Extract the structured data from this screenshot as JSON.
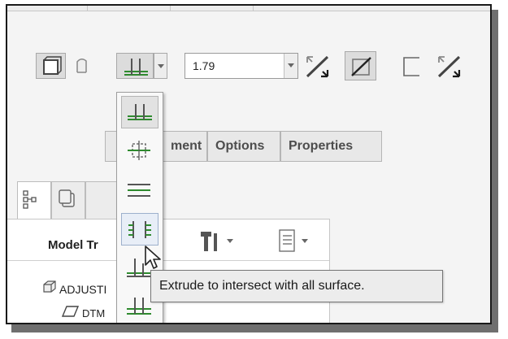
{
  "toolbar": {
    "depth_value": "1.79"
  },
  "tabs": [
    {
      "label": "ment"
    },
    {
      "label": "Options"
    },
    {
      "label": "Properties"
    }
  ],
  "model_tree": {
    "title": "Model Tr",
    "items": [
      {
        "label": "ADJUSTI",
        "icon": "part-icon"
      },
      {
        "label": "DTM",
        "icon": "datum-plane-icon"
      }
    ]
  },
  "depth_menu": {
    "options": [
      {
        "icon": "depth-blind-icon",
        "selected": true
      },
      {
        "icon": "depth-symmetric-icon"
      },
      {
        "icon": "depth-through-next-icon"
      },
      {
        "icon": "depth-through-all-icon",
        "hovered": true
      },
      {
        "icon": "depth-through-until-icon"
      },
      {
        "icon": "depth-to-selected-icon"
      }
    ]
  },
  "tooltip": {
    "text": "Extrude to intersect with all surface."
  },
  "colors": {
    "icon_green": "#2e8a2e",
    "icon_gray": "#555555",
    "background": "#f4f4f4"
  }
}
